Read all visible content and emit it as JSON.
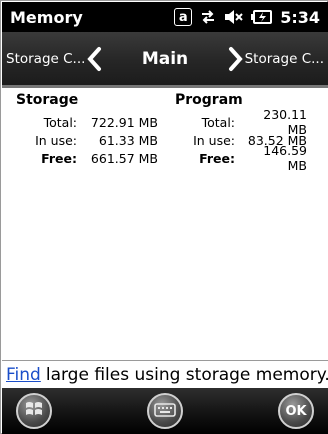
{
  "status_bar": {
    "app_title": "Memory",
    "badge_letter": "a",
    "time": "5:34"
  },
  "nav": {
    "prev_label": "Storage C...",
    "center_title": "Main",
    "next_label": "Storage C..."
  },
  "storage": {
    "title": "Storage",
    "total_label": "Total:",
    "total_value": "722.91 MB",
    "inuse_label": "In use:",
    "inuse_value": "61.33 MB",
    "free_label": "Free:",
    "free_value": "661.57 MB"
  },
  "program": {
    "title": "Program",
    "total_label": "Total:",
    "total_value": "230.11 MB",
    "inuse_label": "In use:",
    "inuse_value": "83.52 MB",
    "free_label": "Free:",
    "free_value": "146.59 MB"
  },
  "find_bar": {
    "link_text": "Find",
    "rest_text": "large files using storage memory."
  },
  "softkeys": {
    "ok_label": "OK"
  },
  "icons": {
    "start": "windows-start-icon",
    "keyboard": "keyboard-icon",
    "connectivity": "sync-arrows-icon",
    "volume": "speaker-muted-icon",
    "battery": "battery-charging-icon"
  }
}
